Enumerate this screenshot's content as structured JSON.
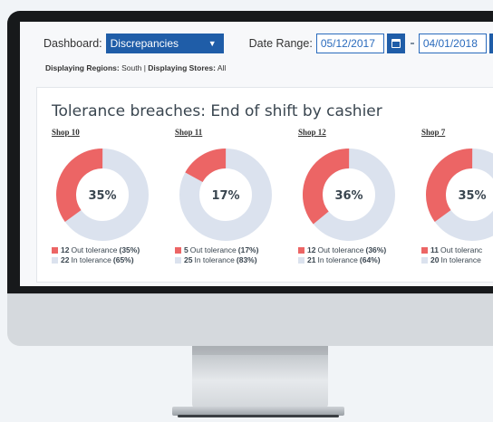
{
  "filters": {
    "dashboard_label": "Dashboard:",
    "dashboard_value": "Discrepancies",
    "date_range_label": "Date Range:",
    "date_from": "05/12/2017",
    "date_to": "04/01/2018"
  },
  "info": {
    "regions_label": "Displaying Regions:",
    "regions_value": "South",
    "separator": "|",
    "stores_label": "Displaying Stores:",
    "stores_value": "All"
  },
  "card": {
    "title": "Tolerance breaches: End of shift by cashier",
    "shops": [
      {
        "name": "Shop 10",
        "percent_label": "35%",
        "out_fraction": 0.35,
        "out_count": "12",
        "out_text": "Out tolerance",
        "out_pct": "(35%)",
        "in_count": "22",
        "in_text": "In tolerance",
        "in_pct": "(65%)"
      },
      {
        "name": "Shop 11",
        "percent_label": "17%",
        "out_fraction": 0.17,
        "out_count": "5",
        "out_text": "Out tolerance",
        "out_pct": "(17%)",
        "in_count": "25",
        "in_text": "In tolerance",
        "in_pct": "(83%)"
      },
      {
        "name": "Shop 12",
        "percent_label": "36%",
        "out_fraction": 0.36,
        "out_count": "12",
        "out_text": "Out tolerance",
        "out_pct": "(36%)",
        "in_count": "21",
        "in_text": "In tolerance",
        "in_pct": "(64%)"
      },
      {
        "name": "Shop 7",
        "percent_label": "35%",
        "out_fraction": 0.35,
        "out_count": "11",
        "out_text": "Out toleranc",
        "out_pct": "",
        "in_count": "20",
        "in_text": "In tolerance",
        "in_pct": ""
      }
    ]
  },
  "colors": {
    "out_tolerance": "#ec6565",
    "in_tolerance": "#dbe2ee",
    "accent": "#1f5da8"
  }
}
